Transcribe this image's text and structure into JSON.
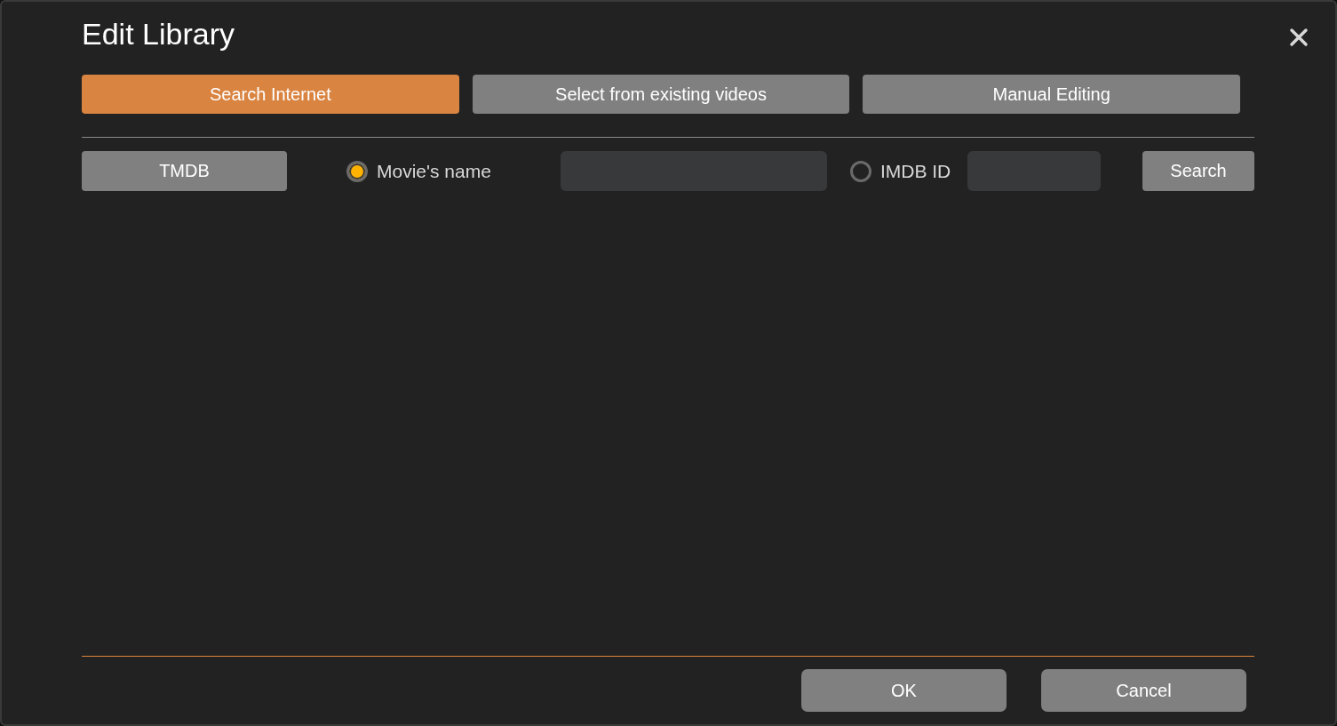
{
  "dialog": {
    "title": "Edit Library"
  },
  "tabs": [
    {
      "label": "Search Internet",
      "selected": true
    },
    {
      "label": "Select from existing videos",
      "selected": false
    },
    {
      "label": "Manual Editing",
      "selected": false
    }
  ],
  "search_bar": {
    "source": "TMDB",
    "options": [
      {
        "label": "Movie's name",
        "selected": true
      },
      {
        "label": "IMDB ID",
        "selected": false
      }
    ],
    "search_button": "Search"
  },
  "buttons": [
    "OK",
    "Cancel"
  ]
}
